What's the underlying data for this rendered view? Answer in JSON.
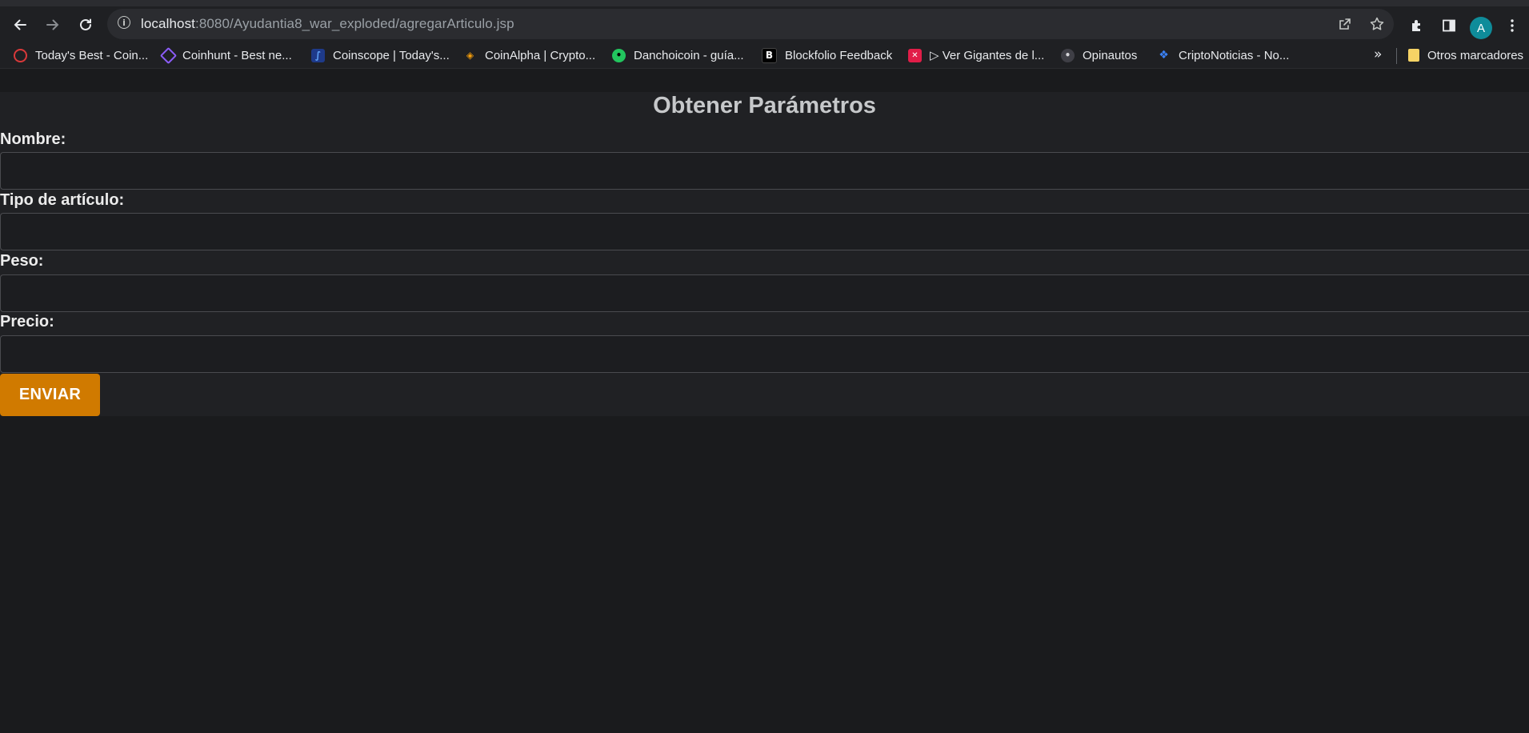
{
  "browser": {
    "url_host": "localhost",
    "url_path": ":8080/Ayudantia8_war_exploded/agregarArticulo.jsp",
    "avatar_letter": "A",
    "icons": {
      "back": "arrow-left-icon",
      "forward": "arrow-right-icon",
      "reload": "reload-icon",
      "info": "info-icon",
      "share": "share-icon",
      "bookmark_star": "star-icon",
      "extensions": "puzzle-icon",
      "side_panel": "side-panel-icon",
      "menu": "kebab-menu-icon"
    }
  },
  "bookmarks": {
    "items": [
      {
        "label": "Today's Best - Coin...",
        "icon": "coinhunt-red-icon",
        "color": "#d9393a"
      },
      {
        "label": "Coinhunt - Best ne...",
        "icon": "coinhunt-purple-icon",
        "color": "#8b5cf6"
      },
      {
        "label": "Coinscope | Today's...",
        "icon": "coinscope-icon",
        "color": "#3b82f6"
      },
      {
        "label": "CoinAlpha | Crypto...",
        "icon": "coinalpha-icon",
        "color": "#f59e0b"
      },
      {
        "label": "Danchoicoin - guía...",
        "icon": "danchoicoin-icon",
        "color": "#22c55e"
      },
      {
        "label": "Blockfolio Feedback",
        "icon": "blockfolio-icon",
        "color": "#000000"
      },
      {
        "label": "▷ Ver Gigantes de l...",
        "icon": "gigantes-icon",
        "color": "#e11d48"
      },
      {
        "label": "Opinautos",
        "icon": "opinautos-icon",
        "color": "#6b7280"
      },
      {
        "label": "CriptoNoticias - No...",
        "icon": "criptonoticias-icon",
        "color": "#3b82f6"
      }
    ],
    "more": "»",
    "other_folder": "Otros marcadores"
  },
  "form": {
    "title": "Obtener Parámetros",
    "fields": [
      {
        "label": "Nombre:",
        "value": ""
      },
      {
        "label": "Tipo de artículo:",
        "value": ""
      },
      {
        "label": "Peso:",
        "value": ""
      },
      {
        "label": "Precio:",
        "value": ""
      }
    ],
    "submit_label": "ENVIAR",
    "accent_color": "#d07a00"
  }
}
